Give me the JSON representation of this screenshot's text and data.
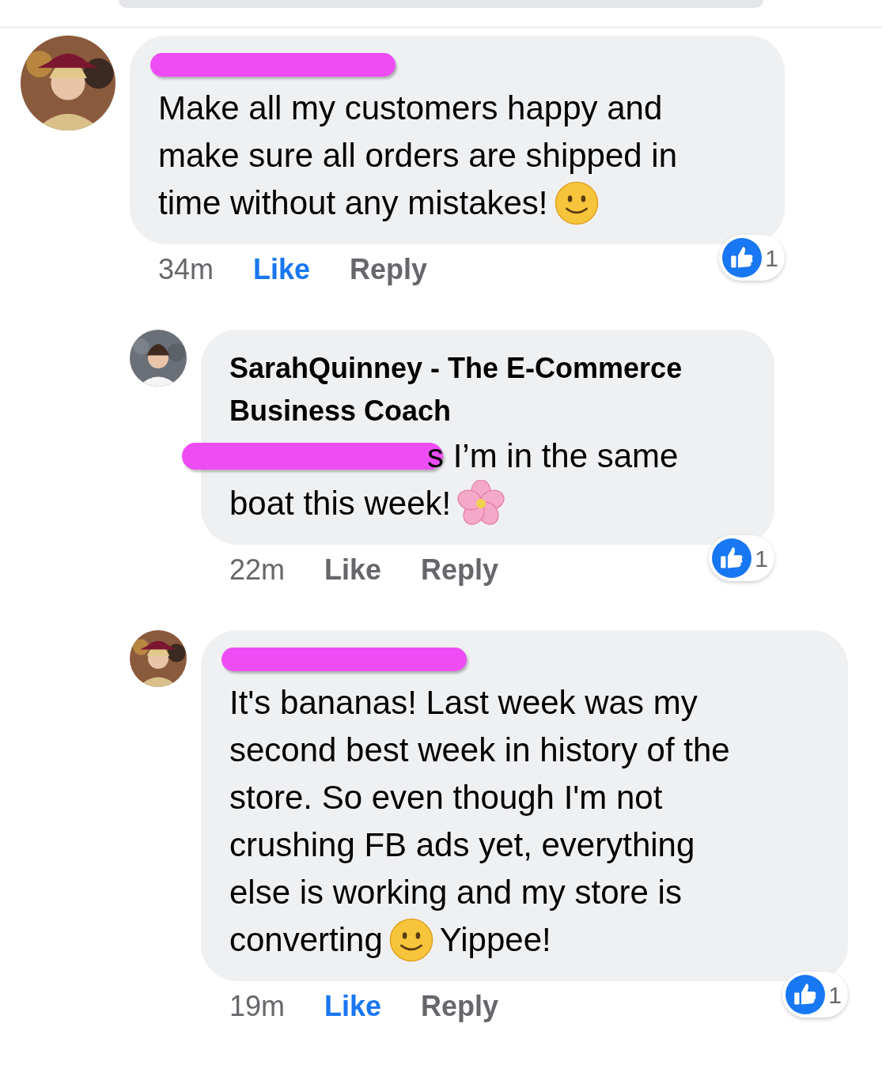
{
  "comments": [
    {
      "indent": false,
      "name_redacted": true,
      "lines": [
        [
          {
            "kind": "text",
            "text": "Make all my customers happy and"
          }
        ],
        [
          {
            "kind": "text",
            "text": "make sure all orders are shipped in"
          }
        ],
        [
          {
            "kind": "text",
            "text": "time without any mistakes!"
          },
          {
            "kind": "smile-emoji"
          }
        ]
      ],
      "time": "34m",
      "like": "Like",
      "liked": true,
      "reply": "Reply",
      "reaction_count": "1"
    },
    {
      "indent": true,
      "name_redacted": false,
      "author": "SarahQuinney - The E-Commerce Business Coach",
      "lines": [
        [
          {
            "kind": "redaction"
          },
          {
            "kind": "text",
            "text": "s I’m in the same"
          }
        ],
        [
          {
            "kind": "text",
            "text": "boat this week!"
          },
          {
            "kind": "blossom-emoji"
          }
        ]
      ],
      "time": "22m",
      "like": "Like",
      "liked": false,
      "reply": "Reply",
      "reaction_count": "1"
    },
    {
      "indent": true,
      "name_redacted": true,
      "lines": [
        [
          {
            "kind": "text",
            "text": "It's bananas! Last week was my"
          }
        ],
        [
          {
            "kind": "text",
            "text": "second best week in history of the"
          }
        ],
        [
          {
            "kind": "text",
            "text": "store. So even though I'm not"
          }
        ],
        [
          {
            "kind": "text",
            "text": "crushing FB ads yet, everything"
          }
        ],
        [
          {
            "kind": "text",
            "text": "else is working and my store is"
          }
        ],
        [
          {
            "kind": "text",
            "text": "converting"
          },
          {
            "kind": "smile-emoji"
          },
          {
            "kind": "text",
            "text": "Yippee!"
          }
        ]
      ],
      "time": "19m",
      "like": "Like",
      "liked": true,
      "reply": "Reply",
      "reaction_count": "1"
    }
  ]
}
